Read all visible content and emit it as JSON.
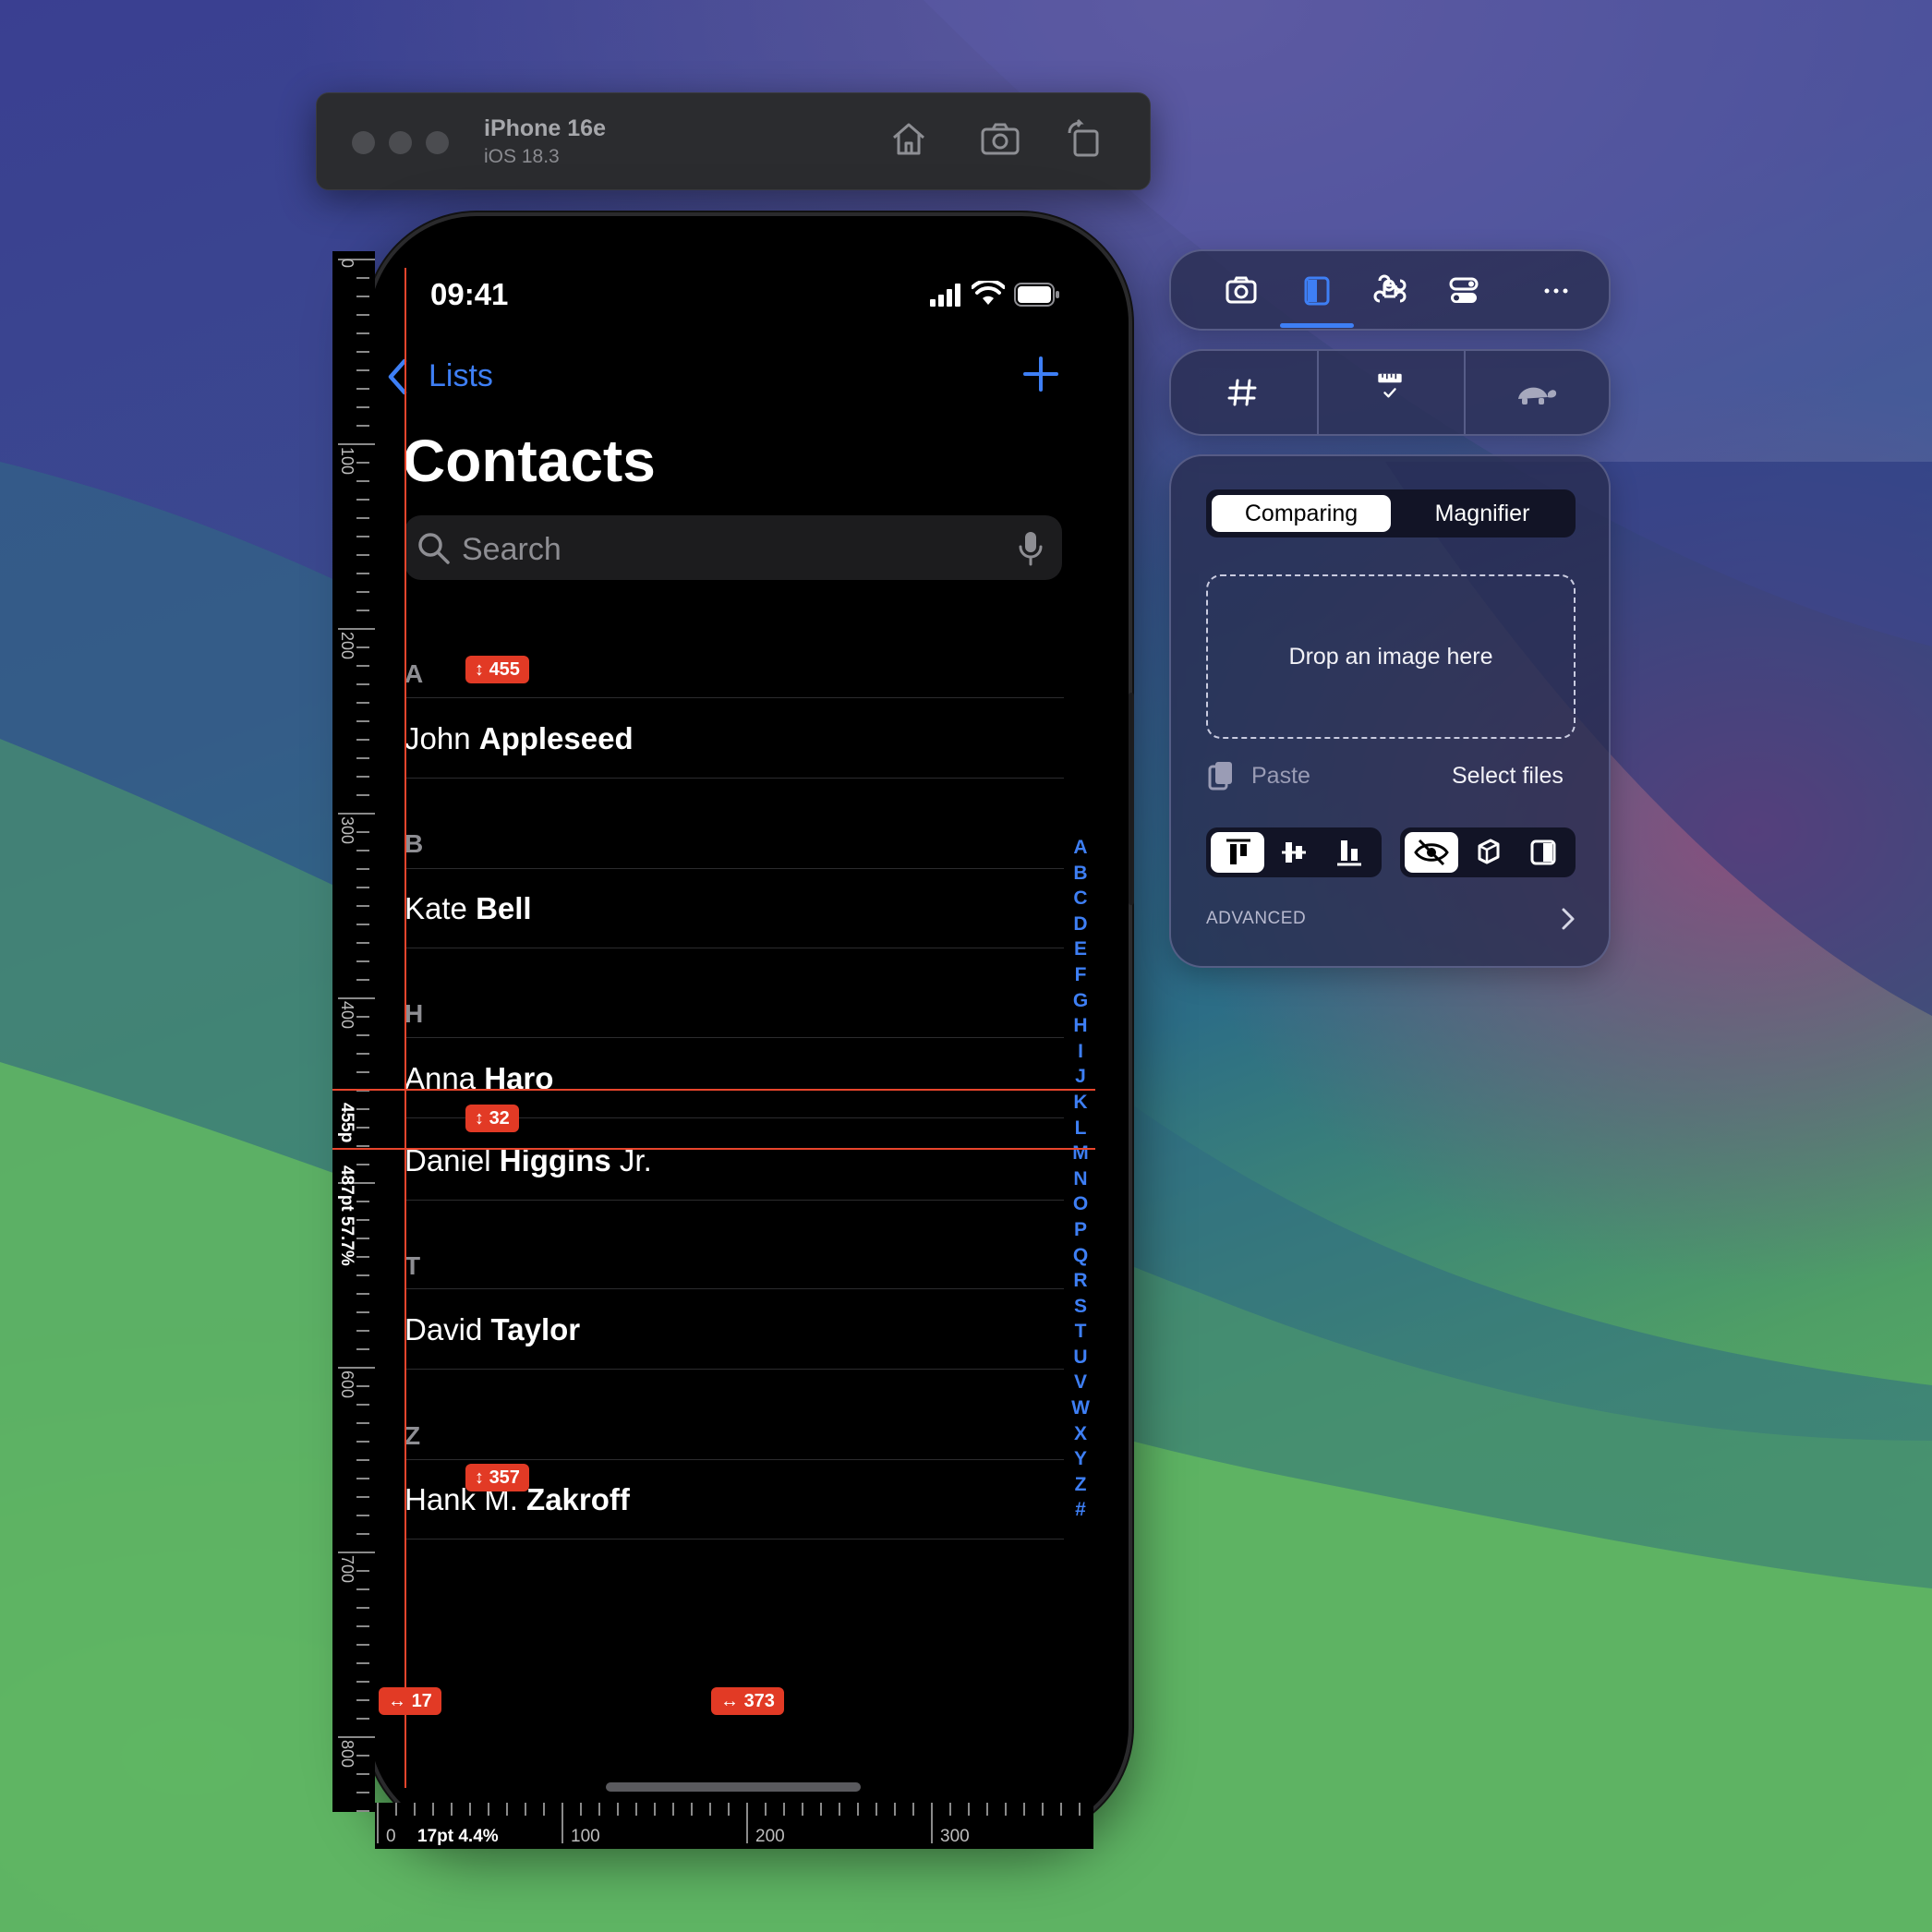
{
  "simulator": {
    "device_name": "iPhone 16e",
    "os_version": "iOS 18.3",
    "icons": [
      "home-icon",
      "screenshot-icon",
      "rotate-icon"
    ]
  },
  "phone": {
    "status_time": "09:41",
    "nav": {
      "back_label": "Lists",
      "add_icon": "plus-icon"
    },
    "title": "Contacts",
    "search": {
      "placeholder": "Search"
    },
    "sections": [
      {
        "letter": "A",
        "contacts": [
          {
            "first": "John",
            "last": "Appleseed",
            "suffix": ""
          }
        ]
      },
      {
        "letter": "B",
        "contacts": [
          {
            "first": "Kate",
            "last": "Bell",
            "suffix": ""
          }
        ]
      },
      {
        "letter": "H",
        "contacts": [
          {
            "first": "Anna",
            "last": "Haro",
            "suffix": ""
          },
          {
            "first": "Daniel",
            "last": "Higgins",
            "suffix": " Jr."
          }
        ]
      },
      {
        "letter": "T",
        "contacts": [
          {
            "first": "David",
            "last": "Taylor",
            "suffix": ""
          }
        ]
      },
      {
        "letter": "Z",
        "contacts": [
          {
            "first": "Hank M.",
            "last": "Zakroff",
            "suffix": ""
          }
        ]
      }
    ],
    "index_letters": [
      "A",
      "B",
      "C",
      "D",
      "E",
      "F",
      "G",
      "H",
      "I",
      "J",
      "K",
      "L",
      "M",
      "N",
      "O",
      "P",
      "Q",
      "R",
      "S",
      "T",
      "U",
      "V",
      "W",
      "X",
      "Y",
      "Z",
      "#"
    ]
  },
  "rulers": {
    "vertical_labels": [
      "0",
      "100",
      "200",
      "300",
      "400",
      "600",
      "700",
      "800"
    ],
    "horizontal_labels": [
      "0",
      "100",
      "200",
      "300"
    ],
    "vertical_measure_a": "455p",
    "vertical_measure_b": "487pt 57.7%",
    "horizontal_measure": "17pt 4.4%"
  },
  "measurements": {
    "badge_455": "455",
    "badge_32": "32",
    "badge_357": "357",
    "badge_17": "17",
    "badge_373": "373"
  },
  "panel": {
    "toolbar_icons": [
      "screenshot-icon",
      "sidebar-compare-icon",
      "command-icon",
      "toggles-icon",
      "more-icon"
    ],
    "tool_icons": [
      "grid-icon",
      "ruler-icon",
      "turtle-icon"
    ],
    "segmented": {
      "option_a": "Comparing",
      "option_b": "Magnifier"
    },
    "drop_zone": "Drop an image here",
    "paste_label": "Paste",
    "select_files_label": "Select files",
    "advanced_label": "ADVANCED"
  },
  "colors": {
    "accent": "#3e7ff5",
    "guide": "#e8452c",
    "badge": "#e23a25"
  }
}
